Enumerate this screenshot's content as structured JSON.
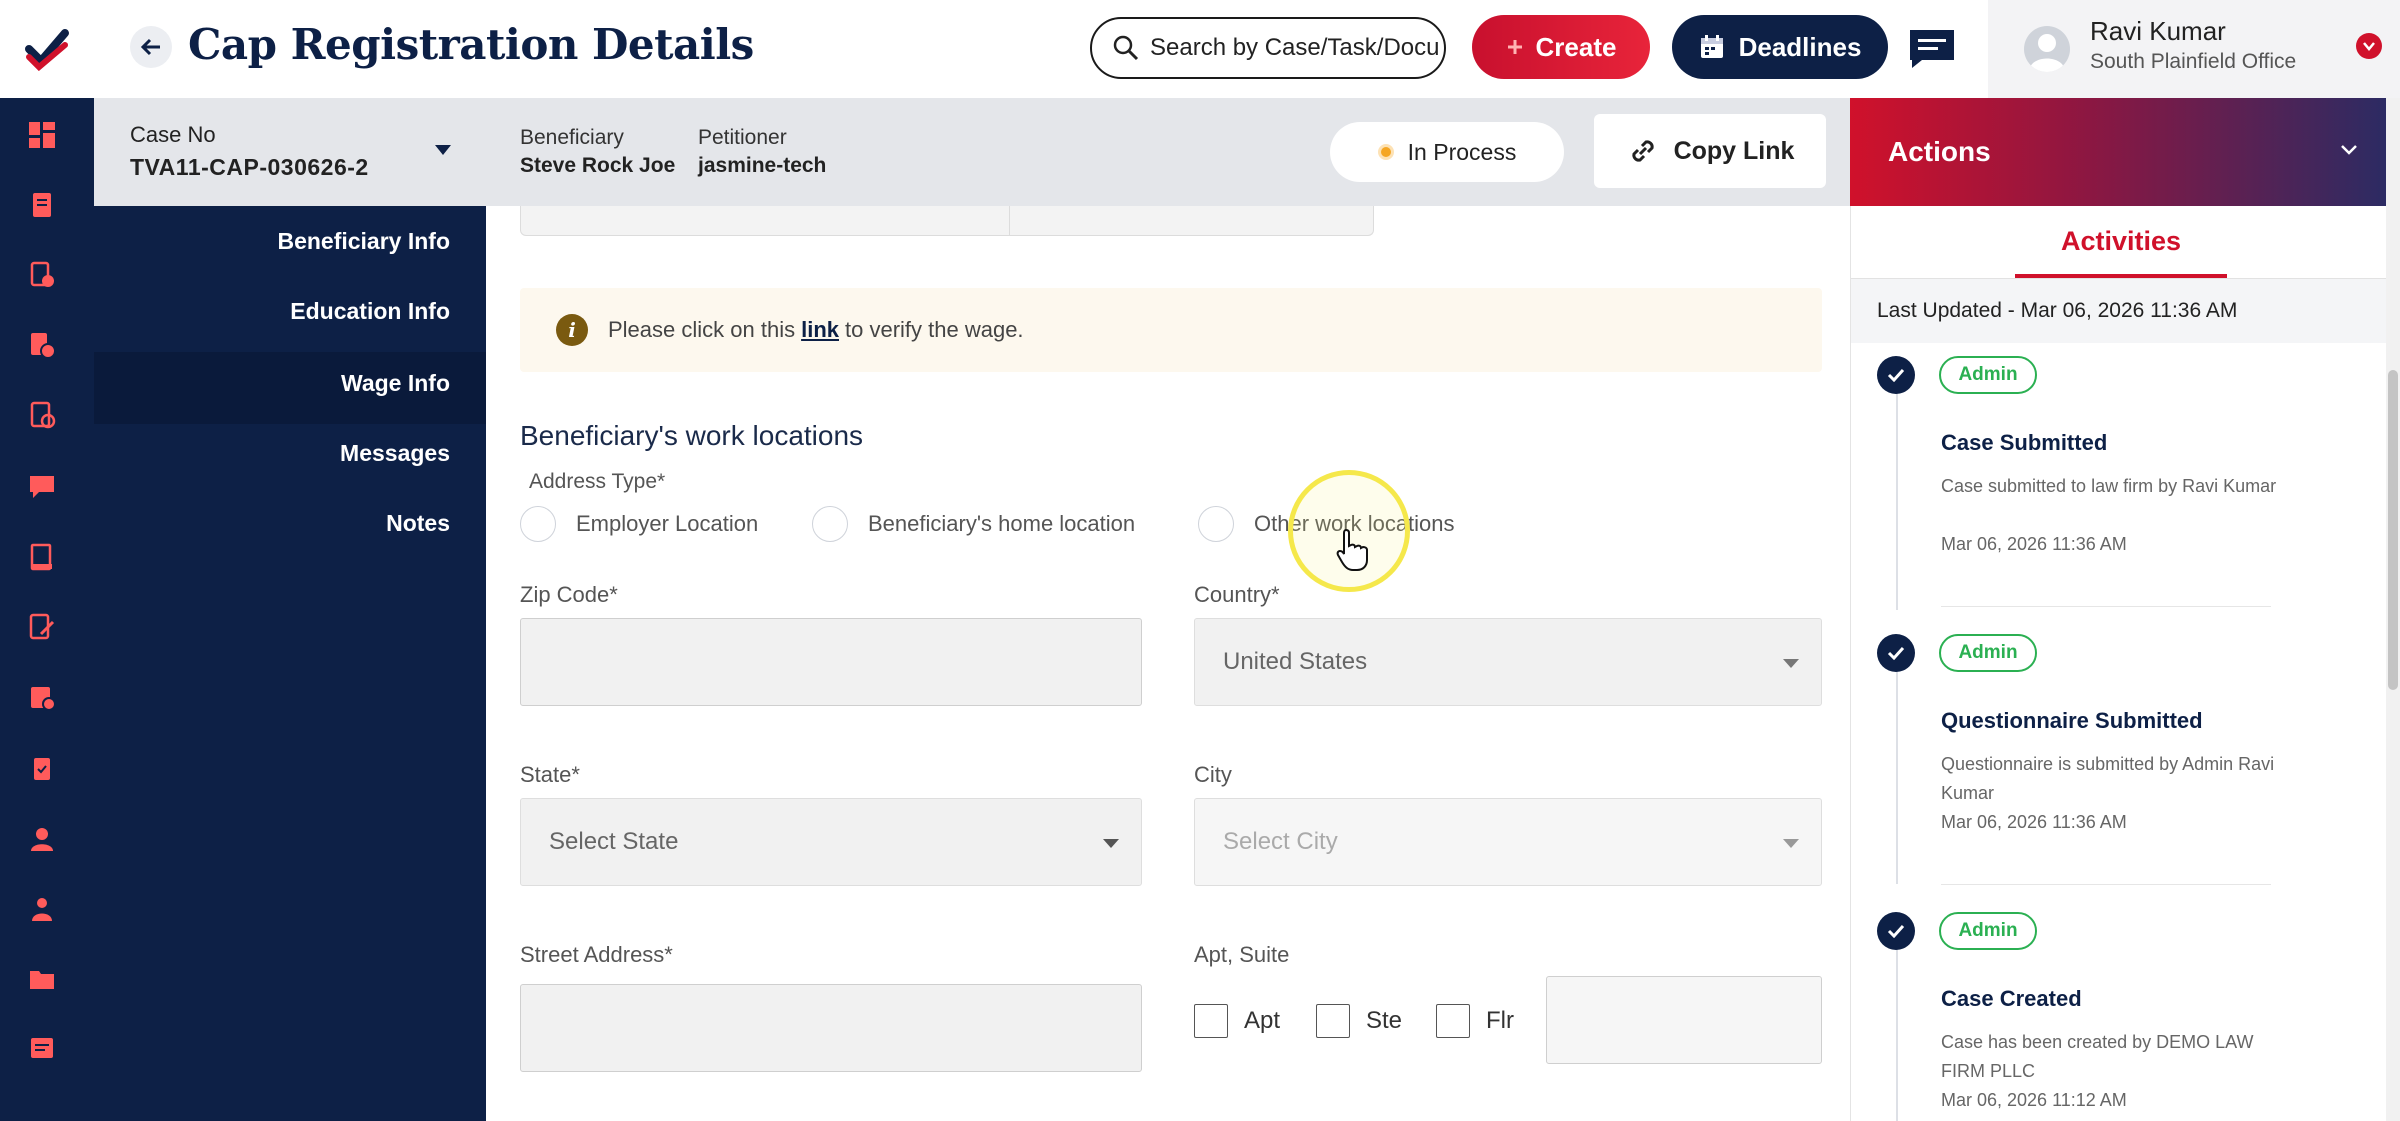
{
  "app": {
    "title": "Cap Registration Details"
  },
  "search": {
    "placeholder": "Search by Case/Task/Document"
  },
  "header": {
    "create_label": "Create",
    "deadlines_label": "Deadlines"
  },
  "user": {
    "name": "Ravi Kumar",
    "office": "South Plainfield Office"
  },
  "case": {
    "case_no_label": "Case No",
    "case_no": "TVA11-CAP-030626-2",
    "beneficiary_label": "Beneficiary",
    "beneficiary": "Steve Rock Joe",
    "petitioner_label": "Petitioner",
    "petitioner": "jasmine-tech",
    "status": "In Process",
    "copy_link_label": "Copy Link"
  },
  "section_nav": {
    "items": [
      {
        "label": "Beneficiary Info"
      },
      {
        "label": "Education Info"
      },
      {
        "label": "Wage Info"
      },
      {
        "label": "Messages"
      },
      {
        "label": "Notes"
      }
    ],
    "active": "Wage Info"
  },
  "form": {
    "info_text_before": "Please click on this",
    "info_link": "link",
    "info_text_after": "to verify the wage.",
    "section_title": "Beneficiary's work locations",
    "address_type_label": "Address Type*",
    "address_type_options": [
      {
        "label": "Employer Location",
        "selected": false
      },
      {
        "label": "Beneficiary's home location",
        "selected": false
      },
      {
        "label": "Other work locations",
        "selected": false
      }
    ],
    "zip_label": "Zip Code*",
    "zip_value": "",
    "country_label": "Country*",
    "country_value": "United States",
    "state_label": "State*",
    "state_placeholder": "Select State",
    "city_label": "City",
    "city_placeholder": "Select City",
    "street_label": "Street Address*",
    "street_value": "",
    "apt_suite_label": "Apt, Suite",
    "apt_options": [
      {
        "label": "Apt",
        "checked": false
      },
      {
        "label": "Ste",
        "checked": false
      },
      {
        "label": "Flr",
        "checked": false
      }
    ],
    "apt_value": ""
  },
  "actions": {
    "title": "Actions",
    "tab_label": "Activities",
    "last_updated": "Last Updated - Mar 06, 2026 11:36 AM",
    "activities": [
      {
        "badge": "Admin",
        "title": "Case Submitted",
        "description": "Case submitted to law firm by Ravi Kumar",
        "time": "Mar 06, 2026 11:36 AM"
      },
      {
        "badge": "Admin",
        "title": "Questionnaire Submitted",
        "description": "Questionnaire is submitted by Admin Ravi Kumar",
        "time": "Mar 06, 2026 11:36 AM"
      },
      {
        "badge": "Admin",
        "title": "Case Created",
        "description": "Case has been created by DEMO LAW FIRM PLLC",
        "time": "Mar 06, 2026 11:12 AM"
      }
    ]
  },
  "colors": {
    "navy": "#0d2046",
    "brand_red": "#d0112b",
    "badge_green": "#2bb052",
    "status_pending": "#f5a623"
  },
  "icons": {
    "rail": [
      "dashboard-icon",
      "case-file-icon",
      "document-check-icon",
      "billing-icon",
      "checklist-icon",
      "chat-icon",
      "ledger-icon",
      "edit-document-icon",
      "calendar-check-icon",
      "clipboard-check-icon",
      "user-icon",
      "team-icon",
      "folder-icon",
      "notes-icon"
    ]
  }
}
